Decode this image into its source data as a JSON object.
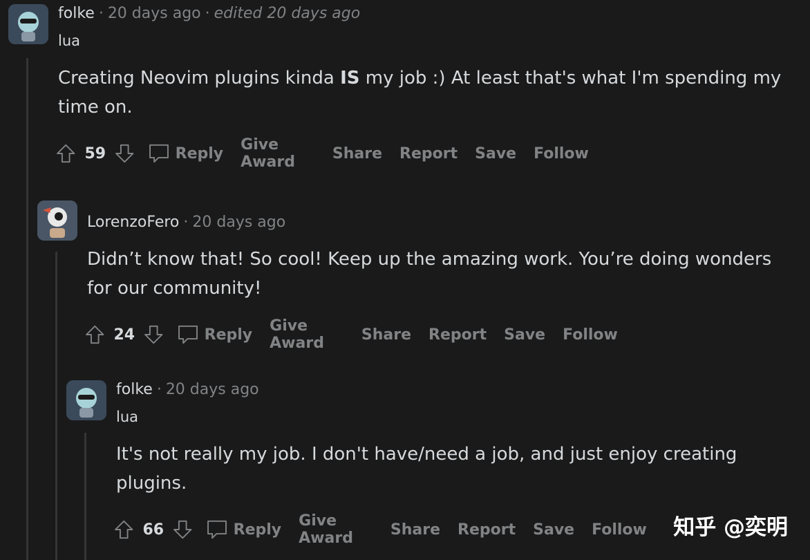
{
  "comments": [
    {
      "author": "folke",
      "time": "20 days ago",
      "edited": "edited 20 days ago",
      "flair": "lua",
      "body_pre": "Creating Neovim plugins kinda ",
      "body_bold": "IS",
      "body_post": " my job :) At least that's what I'm spending my time on.",
      "score": "59"
    },
    {
      "author": "LorenzoFero",
      "time": "20 days ago",
      "body": "Didn’t know that! So cool! Keep up the amazing work. You’re doing wonders for our community!",
      "score": "24"
    },
    {
      "author": "folke",
      "time": "20 days ago",
      "flair": "lua",
      "body": "It's not really my job. I don't have/need a job, and just enjoy creating plugins.",
      "score": "66"
    }
  ],
  "actions": {
    "reply": "Reply",
    "give_award": "Give Award",
    "share": "Share",
    "report": "Report",
    "save": "Save",
    "follow": "Follow"
  },
  "separator": "·",
  "watermark": "知乎 @奕明",
  "icons": [
    "upvote-icon",
    "downvote-icon",
    "comment-icon"
  ],
  "colors": {
    "background": "#1a1a1b",
    "text": "#d7dadc",
    "muted": "#818384",
    "thread": "#343536"
  }
}
